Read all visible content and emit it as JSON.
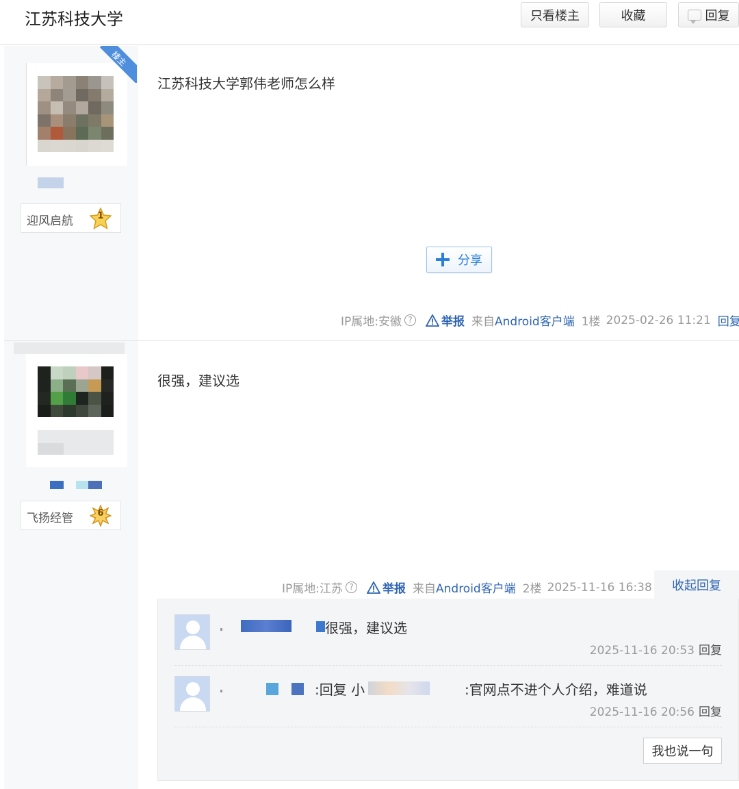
{
  "header": {
    "title": "江苏科技大学",
    "only_owner_label": "只看楼主",
    "favorite_label": "收藏",
    "reply_label": "回复"
  },
  "posts": [
    {
      "is_owner": true,
      "owner_badge": "楼主",
      "level_name": "迎风启航",
      "level_number": "1",
      "content": "江苏科技大学郭伟老师怎么样",
      "share_label": "分享",
      "ip_location": "IP属地:安徽",
      "help_icon": "?",
      "report_label": "举报",
      "from_prefix": "来自",
      "from_client": "Android客户端",
      "floor": "1楼",
      "time": "2025-02-26 11:21",
      "action_label": "回复"
    },
    {
      "is_owner": false,
      "level_name": "飞扬经管",
      "level_number": "6",
      "content": "很强，建议选",
      "ip_location": "IP属地:江苏",
      "help_icon": "?",
      "report_label": "举报",
      "from_prefix": "来自",
      "from_client": "Android客户端",
      "floor": "2楼",
      "time": "2025-11-16 16:38",
      "action_label": "收起回复",
      "replies": [
        {
          "text": "很强，建议选",
          "time": "2025-11-16 20:53",
          "reply_label": "回复"
        },
        {
          "prefix": ":回复 小",
          "text": ":官网点不进个人介绍，难道说",
          "time": "2025-11-16 20:56",
          "reply_label": "回复"
        }
      ],
      "say_button_label": "我也说一句"
    }
  ],
  "icons": {
    "reply": "reply-bubble-icon",
    "share": "plus-share-icon",
    "report": "warning-triangle-icon",
    "help": "help-circle-icon",
    "level": "star-icon",
    "avatar": "default-avatar-icon"
  },
  "colors": {
    "link_blue": "#2d64b3",
    "share_blue": "#2a7fd9",
    "owner_badge": "#4f8edc",
    "sidebar_bg": "#f7f8fa",
    "reply_panel_bg": "#f4f5f7"
  }
}
